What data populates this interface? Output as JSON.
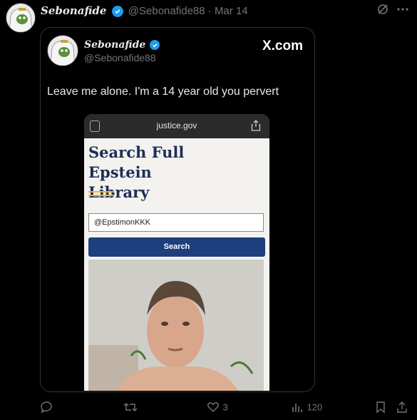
{
  "tweet": {
    "display_name": "Sebonafide",
    "handle": "@Sebonafide88",
    "separator": "·",
    "date": "Mar 14",
    "top_icons": {
      "grok_icon": "grok-icon",
      "more_icon": "more-icon"
    }
  },
  "card": {
    "display_name": "Sebonafide",
    "handle": "@Sebonafide88",
    "brand": "X.com",
    "text": "Leave me alone. I'm a 14 year old you pervert",
    "phone": {
      "url": "justice.gov",
      "title_line1": "Search Full Epstein",
      "title_line2": "Library",
      "input_value": "@EpstimonKKK",
      "search_label": "Search",
      "accent_gold": "#e6b43a",
      "button_color": "#1e3f7d"
    }
  },
  "actions": {
    "reply_count": "",
    "retweet_count": "",
    "like_count": "3",
    "view_count": "120"
  },
  "colors": {
    "background": "#000000",
    "verified": "#1d9bf0",
    "muted": "#71767b"
  }
}
